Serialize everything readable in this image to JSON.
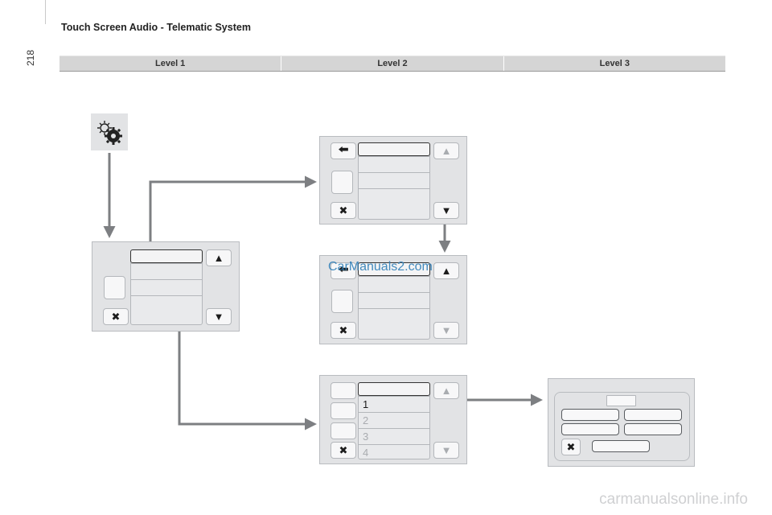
{
  "page": {
    "number": "218",
    "title": "Touch Screen Audio - Telematic System"
  },
  "levels": [
    "Level 1",
    "Level 2",
    "Level 3"
  ],
  "icons": {
    "settings": "settings-gears-icon",
    "back": "back-arrow-icon",
    "close": "close-x-icon",
    "up": "up-triangle-icon",
    "down": "down-triangle-icon"
  },
  "lists": {
    "numbered": [
      "1",
      "2",
      "3",
      "4"
    ]
  },
  "watermarks": {
    "primary": "CarManuals2.com",
    "secondary": "carmanualsonline.info"
  },
  "colors": {
    "panel": "#e2e3e5",
    "arrow": "#7d7f82",
    "watermark_blue": "#2f7fb8"
  }
}
